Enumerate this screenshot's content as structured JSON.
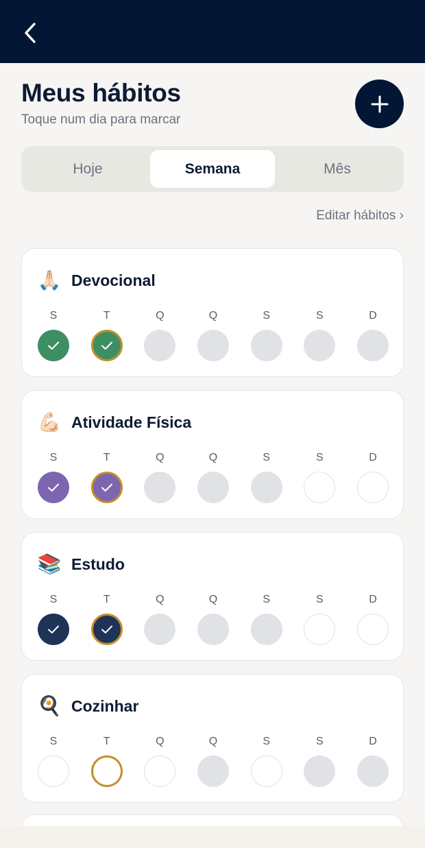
{
  "header": {
    "title": "Meus hábitos",
    "subtitle": "Toque num dia para marcar"
  },
  "tabs": [
    {
      "label": "Hoje",
      "active": false
    },
    {
      "label": "Semana",
      "active": true
    },
    {
      "label": "Mês",
      "active": false
    }
  ],
  "edit_link": "Editar hábitos ›",
  "colors": {
    "topbar": "#031633",
    "today_ring": "#c38f2c",
    "pending": "#e0e2e6"
  },
  "day_letters": [
    "S",
    "T",
    "Q",
    "Q",
    "S",
    "S",
    "D"
  ],
  "habits": [
    {
      "name": "Devocional",
      "icon": "praying-hands-icon",
      "emoji": "🙏🏻",
      "color": "#3d8f63",
      "days": [
        "done",
        "done-today",
        "future",
        "future",
        "future",
        "future",
        "future"
      ]
    },
    {
      "name": "Atividade Física",
      "icon": "flexed-biceps-icon",
      "emoji": "💪🏻",
      "color": "#7e65b0",
      "days": [
        "done",
        "done-today",
        "future",
        "future",
        "future",
        "empty",
        "empty"
      ]
    },
    {
      "name": "Estudo",
      "icon": "books-icon",
      "emoji": "📚",
      "color": "#1d3357",
      "days": [
        "done",
        "done-today",
        "future",
        "future",
        "future",
        "empty",
        "empty"
      ]
    },
    {
      "name": "Cozinhar",
      "icon": "frying-pan-icon",
      "emoji": "🍳",
      "color": "#c38f2c",
      "days": [
        "empty",
        "empty-today",
        "empty",
        "future",
        "empty",
        "future",
        "future"
      ]
    }
  ]
}
